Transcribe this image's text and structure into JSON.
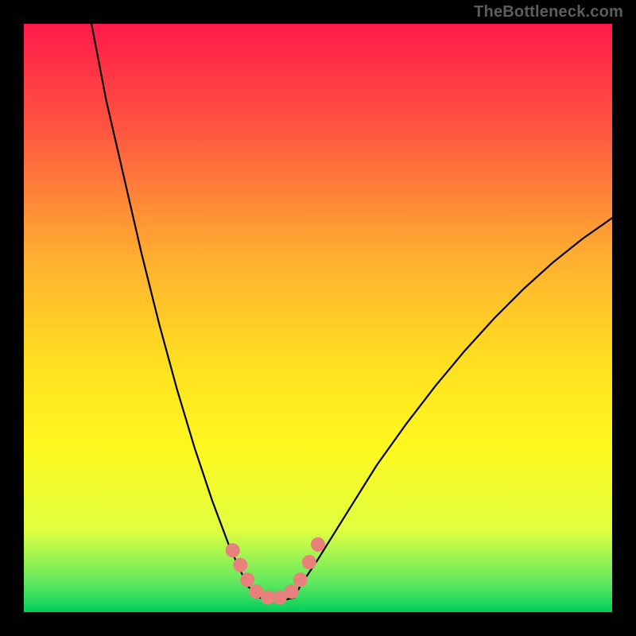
{
  "watermark": "TheBottleneck.com",
  "chart_data": {
    "type": "line",
    "title": "",
    "xlabel": "",
    "ylabel": "",
    "xlim": [
      0,
      100
    ],
    "ylim": [
      0,
      100
    ],
    "background_gradient": [
      "#ff1a4a",
      "#ff5640",
      "#ffb030",
      "#ffe020",
      "#fff820",
      "#e0ff40",
      "#60e860",
      "#00cf5a"
    ],
    "series": [
      {
        "name": "curve-left",
        "x": [
          11.5,
          14,
          17,
          20,
          23,
          26,
          29,
          32,
          35,
          38
        ],
        "values": [
          100,
          87,
          74,
          61,
          49,
          38,
          28,
          19,
          11,
          4.5
        ]
      },
      {
        "name": "curve-right",
        "x": [
          47,
          50,
          55,
          60,
          65,
          70,
          75,
          80,
          85,
          90,
          95,
          100
        ],
        "values": [
          4.5,
          9,
          17,
          25,
          32,
          38.5,
          44.5,
          50,
          55,
          59.5,
          63.5,
          67
        ]
      },
      {
        "name": "valley-floor",
        "x": [
          38,
          40,
          42,
          44,
          46,
          47
        ],
        "values": [
          4.5,
          2.5,
          2,
          2,
          2.5,
          4.5
        ]
      }
    ],
    "highlight_band_y": [
      0,
      5
    ],
    "highlight_band_color": "#e8817c",
    "scatter": {
      "name": "highlight-dots",
      "color": "#e8817c",
      "radius": 9,
      "points": [
        [
          35.5,
          10.5
        ],
        [
          36.8,
          8.0
        ],
        [
          38.0,
          5.5
        ],
        [
          39.5,
          3.5
        ],
        [
          41.5,
          2.5
        ],
        [
          43.5,
          2.5
        ],
        [
          45.5,
          3.5
        ],
        [
          47.0,
          5.5
        ],
        [
          48.5,
          8.5
        ],
        [
          50.0,
          11.5
        ]
      ]
    }
  }
}
